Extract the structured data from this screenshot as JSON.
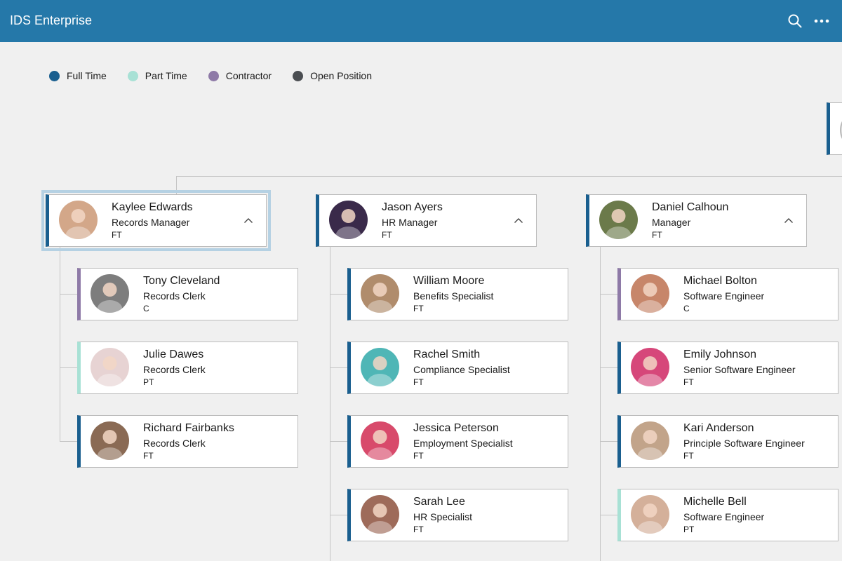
{
  "app": {
    "title": "IDS Enterprise"
  },
  "toolbar": {
    "search_icon": "search-icon",
    "more_icon": "more-horizontal-icon"
  },
  "legend": [
    {
      "label": "Full Time",
      "color": "#1a5f8f"
    },
    {
      "label": "Part Time",
      "color": "#a8e1d5"
    },
    {
      "label": "Contractor",
      "color": "#8e7aa7"
    },
    {
      "label": "Open Position",
      "color": "#4b4e52"
    }
  ],
  "status_colors": {
    "FT": "#1a5f8f",
    "PT": "#a8e1d5",
    "C": "#8e7aa7"
  },
  "managers": [
    {
      "name": "Kaylee Edwards",
      "title": "Records Manager",
      "type": "FT",
      "avatar_color": "#d3a789",
      "selected": true,
      "reports": [
        {
          "name": "Tony Cleveland",
          "title": "Records Clerk",
          "type": "C",
          "avatar_color": "#7d7d7d"
        },
        {
          "name": "Julie Dawes",
          "title": "Records Clerk",
          "type": "PT",
          "avatar_color": "#e7d3d3"
        },
        {
          "name": "Richard Fairbanks",
          "title": "Records Clerk",
          "type": "FT",
          "avatar_color": "#8a6a54"
        }
      ]
    },
    {
      "name": "Jason Ayers",
      "title": "HR Manager",
      "type": "FT",
      "avatar_color": "#3a2a4a",
      "selected": false,
      "reports": [
        {
          "name": "William Moore",
          "title": "Benefits Specialist",
          "type": "FT",
          "avatar_color": "#b08c6c"
        },
        {
          "name": "Rachel Smith",
          "title": "Compliance Specialist",
          "type": "FT",
          "avatar_color": "#4fb6b6"
        },
        {
          "name": "Jessica Peterson",
          "title": "Employment Specialist",
          "type": "FT",
          "avatar_color": "#d84a6b"
        },
        {
          "name": "Sarah Lee",
          "title": "HR Specialist",
          "type": "FT",
          "avatar_color": "#9e6b5a"
        }
      ]
    },
    {
      "name": "Daniel Calhoun",
      "title": "Manager",
      "type": "FT",
      "avatar_color": "#6b7a4a",
      "selected": false,
      "reports": [
        {
          "name": "Michael Bolton",
          "title": "Software Engineer",
          "type": "C",
          "avatar_color": "#c7866a"
        },
        {
          "name": "Emily Johnson",
          "title": "Senior Software Engineer",
          "type": "FT",
          "avatar_color": "#d6477a"
        },
        {
          "name": "Kari Anderson",
          "title": "Principle Software Engineer",
          "type": "FT",
          "avatar_color": "#c2a48a"
        },
        {
          "name": "Michelle Bell",
          "title": "Software Engineer",
          "type": "PT",
          "avatar_color": "#d4b09a"
        }
      ]
    }
  ]
}
